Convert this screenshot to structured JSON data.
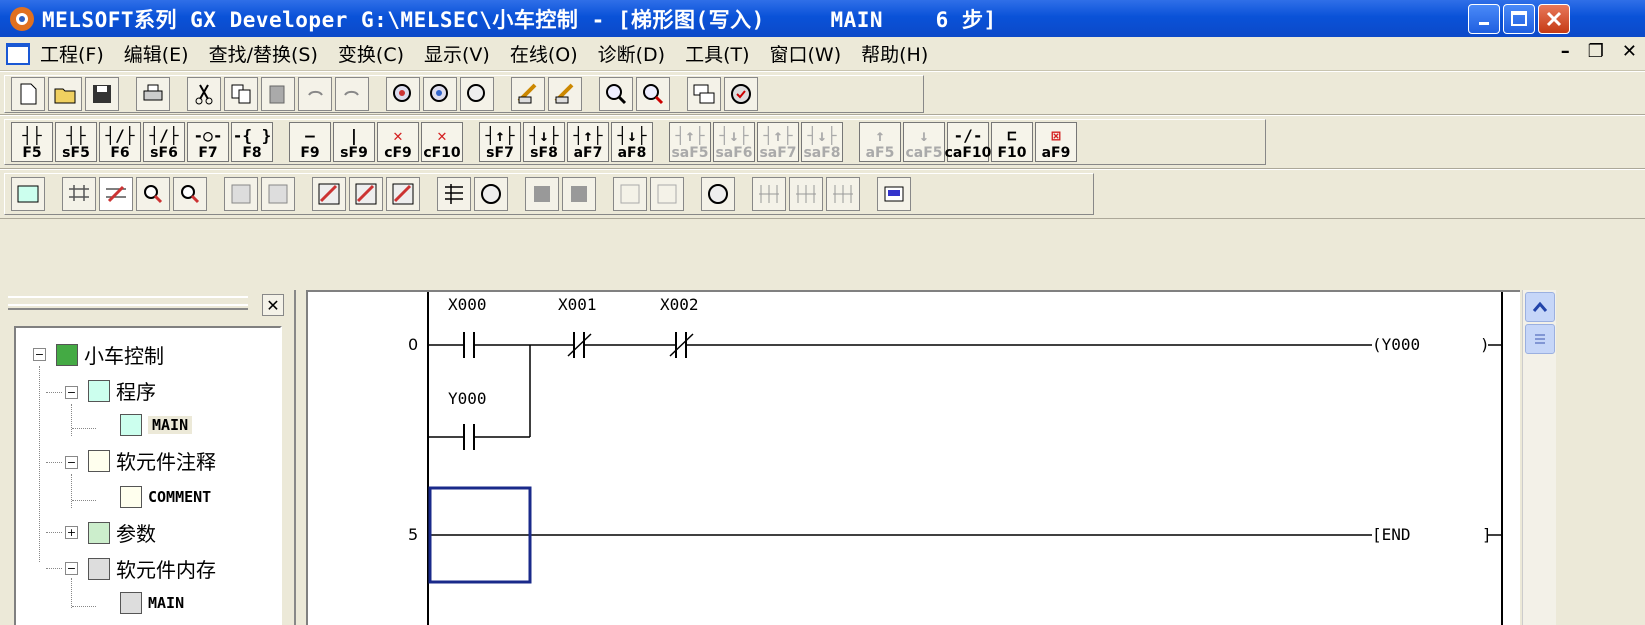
{
  "window": {
    "title": "MELSOFT系列 GX Developer G:\\MELSEC\\小车控制 - [梯形图(写入)     MAIN    6 步]"
  },
  "menu": {
    "items": [
      "工程(F)",
      "编辑(E)",
      "查找/替换(S)",
      "变换(C)",
      "显示(V)",
      "在线(O)",
      "诊断(D)",
      "工具(T)",
      "窗口(W)",
      "帮助(H)"
    ]
  },
  "ladder_toolbar": {
    "buttons": [
      {
        "sym": "┤├",
        "key": "F5"
      },
      {
        "sym": "┤├",
        "key": "sF5"
      },
      {
        "sym": "┤/├",
        "key": "F6"
      },
      {
        "sym": "┤/├",
        "key": "sF6"
      },
      {
        "sym": "-○-",
        "key": "F7"
      },
      {
        "sym": "-{ }",
        "key": "F8"
      },
      {
        "sym": "—",
        "key": "F9"
      },
      {
        "sym": "|",
        "key": "sF9"
      },
      {
        "sym": "✕",
        "key": "cF9"
      },
      {
        "sym": "✕",
        "key": "cF10"
      },
      {
        "sym": "┤↑├",
        "key": "sF7"
      },
      {
        "sym": "┤↓├",
        "key": "sF8"
      },
      {
        "sym": "┤↑├",
        "key": "aF7"
      },
      {
        "sym": "┤↓├",
        "key": "aF8"
      },
      {
        "sym": "┤↑├",
        "key": "saF5"
      },
      {
        "sym": "┤↓├",
        "key": "saF6"
      },
      {
        "sym": "┤↑├",
        "key": "saF7"
      },
      {
        "sym": "┤↓├",
        "key": "saF8"
      },
      {
        "sym": "↑",
        "key": "aF5"
      },
      {
        "sym": "↓",
        "key": "caF5"
      },
      {
        "sym": "-/-",
        "key": "caF10"
      },
      {
        "sym": "⊏",
        "key": "F10"
      },
      {
        "sym": "⊠",
        "key": "aF9"
      }
    ]
  },
  "project_tree": {
    "root": "小车控制",
    "program": "程序",
    "program_main": "MAIN",
    "comment": "软元件注释",
    "comment_item": "COMMENT",
    "params": "参数",
    "memory": "软元件内存",
    "memory_main": "MAIN"
  },
  "ladder": {
    "rung0_step": "0",
    "rung1_step": "5",
    "contact_x000": "X000",
    "contact_x001": "X001",
    "contact_x002": "X002",
    "contact_y000": "Y000",
    "coil": "(Y000",
    "coil_close": ")",
    "end": "[END",
    "end_close": "]"
  }
}
